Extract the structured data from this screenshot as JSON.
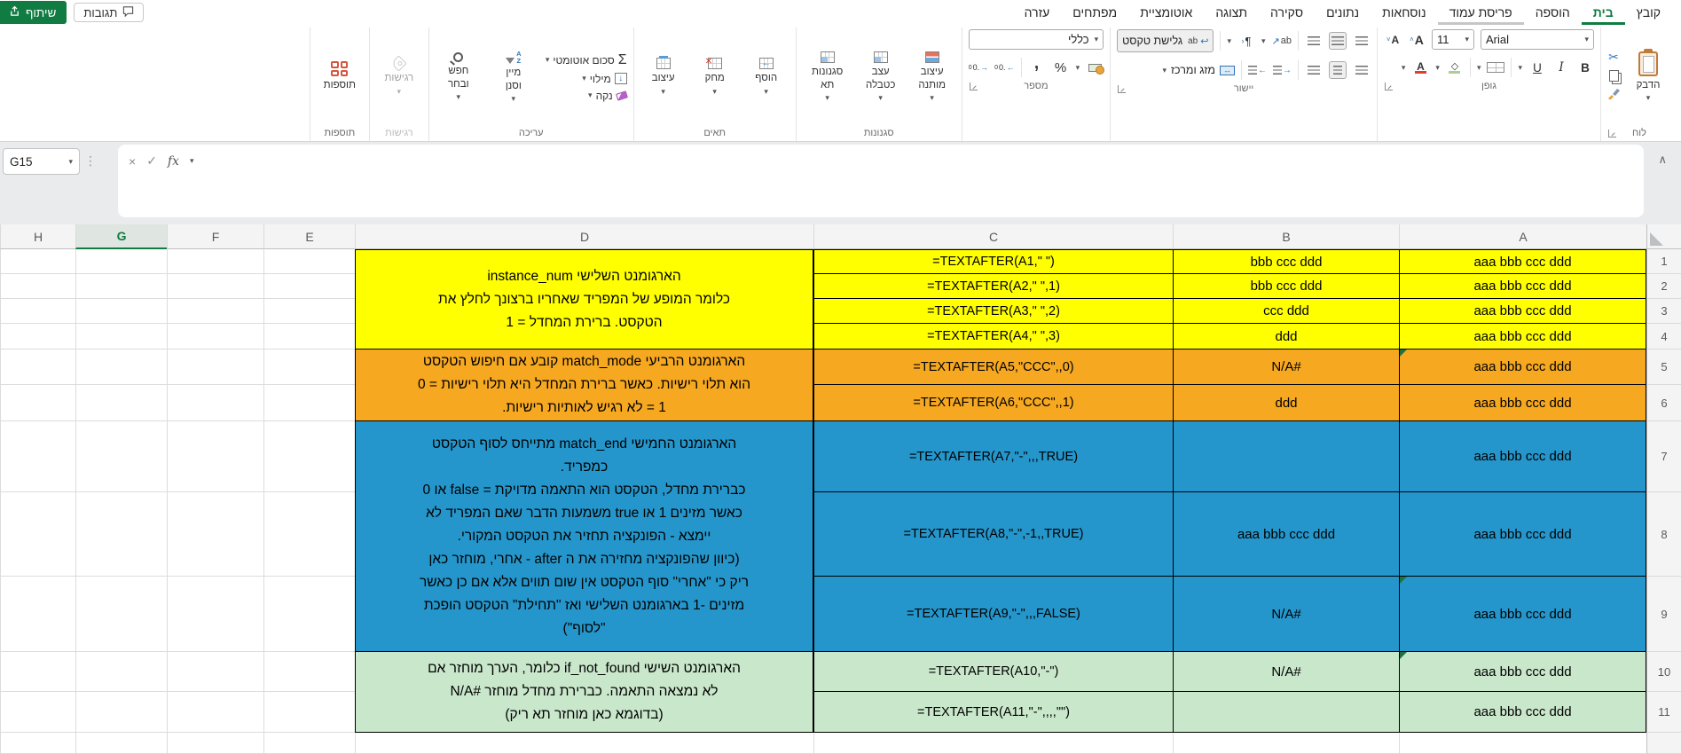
{
  "chrome": {
    "share_label": "שיתוף",
    "comments_label": "תגובות",
    "tabs": [
      {
        "label": "קובץ"
      },
      {
        "label": "בית",
        "active": true
      },
      {
        "label": "הוספה"
      },
      {
        "label": "פריסת עמוד",
        "hover": true
      },
      {
        "label": "נוסחאות"
      },
      {
        "label": "נתונים"
      },
      {
        "label": "סקירה"
      },
      {
        "label": "תצוגה"
      },
      {
        "label": "אוטומציית"
      },
      {
        "label": "מפתחים"
      },
      {
        "label": "עזרה"
      }
    ]
  },
  "ribbon": {
    "clipboard": {
      "paste": "הדבק",
      "label": "לוח"
    },
    "font": {
      "name": "Arial",
      "size": "11",
      "label": "גופן"
    },
    "alignment": {
      "wrap": "גלישת טקסט",
      "merge": "מזג ומרכז",
      "label": "יישור"
    },
    "number": {
      "format": "כללי",
      "label": "מספר"
    },
    "styles": {
      "conditional": "עיצוב מותנה",
      "table": "עצב כטבלה",
      "cell": "סגנונות תא",
      "label": "סגנונות"
    },
    "cells": {
      "insert": "הוסף",
      "delete": "מחק",
      "format": "עיצוב",
      "label": "תאים"
    },
    "editing": {
      "autosum": "סכום אוטומטי",
      "fill": "מילוי",
      "clear": "נקה",
      "sort": "מיין וסנן",
      "find": "חפש ובחר",
      "label": "עריכה"
    },
    "sensitivity": {
      "button": "רגישות",
      "label": "רגישות"
    },
    "addins": {
      "button": "תוספות",
      "label": "תוספות"
    }
  },
  "formula_bar": {
    "name_box": "G15",
    "fx_label": "fx",
    "value": ""
  },
  "sheet": {
    "col_headers": [
      "H",
      "G",
      "F",
      "E",
      "D",
      "C",
      "B",
      "A"
    ],
    "selected_column": "G",
    "rows": [
      {
        "n": "1",
        "a": "aaa bbb ccc ddd",
        "b": "bbb ccc ddd",
        "c": "=TEXTAFTER(A1,\" \")",
        "color": "yellow"
      },
      {
        "n": "2",
        "a": "aaa bbb ccc ddd",
        "b": "bbb ccc ddd",
        "c": "=TEXTAFTER(A2,\" \",1)",
        "color": "yellow"
      },
      {
        "n": "3",
        "a": "aaa bbb ccc ddd",
        "b": "ccc ddd",
        "c": "=TEXTAFTER(A3,\" \",2)",
        "color": "yellow"
      },
      {
        "n": "4",
        "a": "aaa bbb ccc ddd",
        "b": "ddd",
        "c": "=TEXTAFTER(A4,\" \",3)",
        "color": "yellow"
      },
      {
        "n": "5",
        "a": "aaa bbb ccc ddd",
        "b": "#N/A",
        "c": "=TEXTAFTER(A5,\"CCC\",,0)",
        "color": "orange",
        "tri": true
      },
      {
        "n": "6",
        "a": "aaa bbb ccc ddd",
        "b": "ddd",
        "c": "=TEXTAFTER(A6,\"CCC\",,1)",
        "color": "orange"
      },
      {
        "n": "7",
        "a": "aaa bbb ccc ddd",
        "b": "",
        "c": "=TEXTAFTER(A7,\"-\",,,TRUE)",
        "color": "blue"
      },
      {
        "n": "8",
        "a": "aaa bbb ccc ddd",
        "b": "aaa bbb ccc ddd",
        "c": "=TEXTAFTER(A8,\"-\",-1,,TRUE)",
        "color": "blue"
      },
      {
        "n": "9",
        "a": "aaa bbb ccc ddd",
        "b": "#N/A",
        "c": "=TEXTAFTER(A9,\"-\",,,FALSE)",
        "color": "blue",
        "tri": true
      },
      {
        "n": "10",
        "a": "aaa bbb ccc ddd",
        "b": "#N/A",
        "c": "=TEXTAFTER(A10,\"-\")",
        "color": "green",
        "tri": true
      },
      {
        "n": "11",
        "a": "aaa bbb ccc ddd",
        "b": "",
        "c": "=TEXTAFTER(A11,\"-\",,,,\"\")",
        "color": "green"
      }
    ],
    "d_blocks": [
      {
        "rows": "1-4",
        "color": "yellow",
        "lines": [
          "הארגומנט השלישי instance_num",
          "כלומר המופע של המפריד שאחריו ברצונך לחלץ את",
          "הטקסט. ברירת המחדל = 1"
        ]
      },
      {
        "rows": "5-6",
        "color": "orange",
        "lines": [
          "הארגומנט הרביעי match_mode קובע אם חיפוש הטקסט",
          "הוא תלוי רישיות. כאשר ברירת המחדל היא תלוי רישיות = 0",
          "1 = לא רגיש לאותיות רישיות."
        ]
      },
      {
        "rows": "7-9",
        "color": "blue",
        "lines": [
          "הארגומנט החמישי match_end  מתייחס לסוף הטקסט",
          "כמפריד.",
          "כברירת מחדל, הטקסט הוא התאמה מדויקת = false או 0",
          "כאשר מזינים 1 או true משמעות הדבר שאם המפריד לא",
          "יימצא - הפונקציה תחזיר את הטקסט המקורי.",
          "(כיוון שהפונקציה מחזירה את ה after - אחרי, מוחזר כאן",
          "ריק כי \"אחרי\" סוף הטקסט אין שום תווים אלא אם כן כאשר",
          "מזינים -1 בארגומנט השלישי ואז \"תחילת\" הטקסט הופכת",
          "\"לסוף\")"
        ]
      },
      {
        "rows": "10-11",
        "color": "green",
        "lines": [
          "הארגומנט השישי if_not_found כלומר, הערך מוחזר אם",
          "לא נמצאה התאמה. כברירת מחדל מוחזר #N/A",
          "(בדוגמא כאן מוחזר תא ריק)"
        ]
      }
    ]
  },
  "colors": {
    "yellow": "#FFFF00",
    "orange": "#F6A821",
    "blue": "#2596CB",
    "green": "#C9E7CB",
    "accent_green": "#107C41"
  }
}
